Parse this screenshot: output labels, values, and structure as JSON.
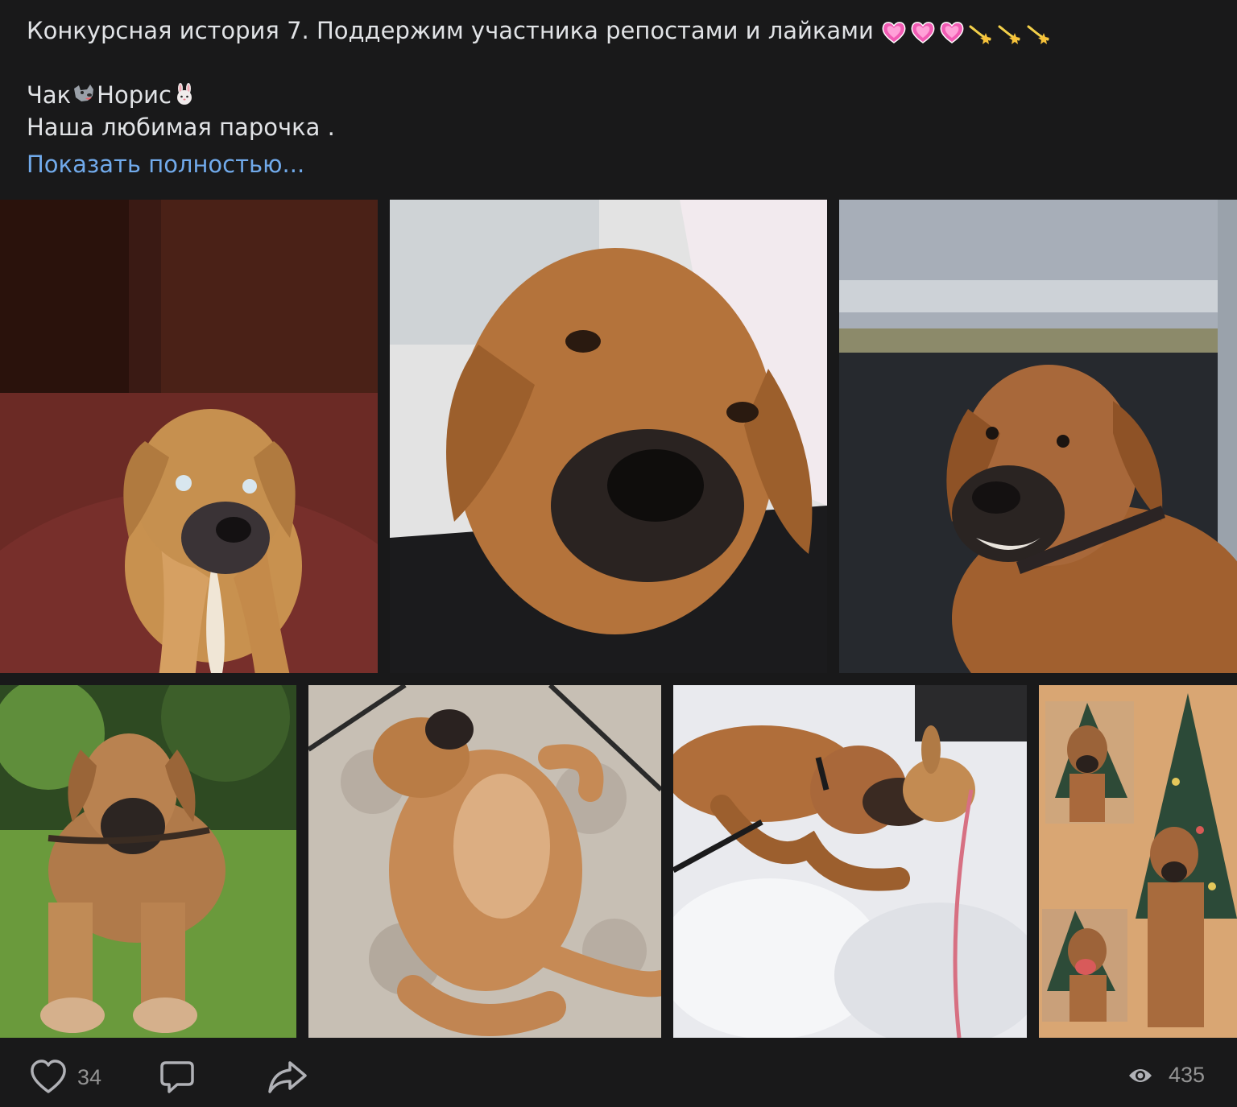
{
  "post": {
    "title_line": "Конкурсная история 7. Поддержим участника репостами и лайками",
    "title_emojis": [
      "heart-emoji",
      "heart-emoji",
      "heart-emoji",
      "dizzy-emoji",
      "dizzy-emoji",
      "dizzy-emoji"
    ],
    "name_part1": "Чак",
    "name_part2": "Норис",
    "name_emojis": [
      "wolf-emoji",
      "rabbit-emoji"
    ],
    "subtitle": "Наша любимая парочка .",
    "show_more": "Показать полностью..."
  },
  "photos": [
    {
      "name": "photo-puppy-sitting"
    },
    {
      "name": "photo-dog-closeup"
    },
    {
      "name": "photo-dog-in-car"
    },
    {
      "name": "photo-dog-on-grass"
    },
    {
      "name": "photo-dog-sleeping"
    },
    {
      "name": "photo-dog-and-rabbit-snow"
    },
    {
      "name": "photo-dog-christmas-collage"
    }
  ],
  "actions": {
    "likes": "34",
    "views": "435"
  },
  "icons": {
    "like": "heart-outline-icon",
    "comment": "comment-icon",
    "share": "share-arrow-icon",
    "views": "eye-icon"
  },
  "colors": {
    "background": "#19191a",
    "text": "#e1e3e6",
    "link": "#71aaeb",
    "icon": "#b0b1b6",
    "count": "#939393"
  }
}
